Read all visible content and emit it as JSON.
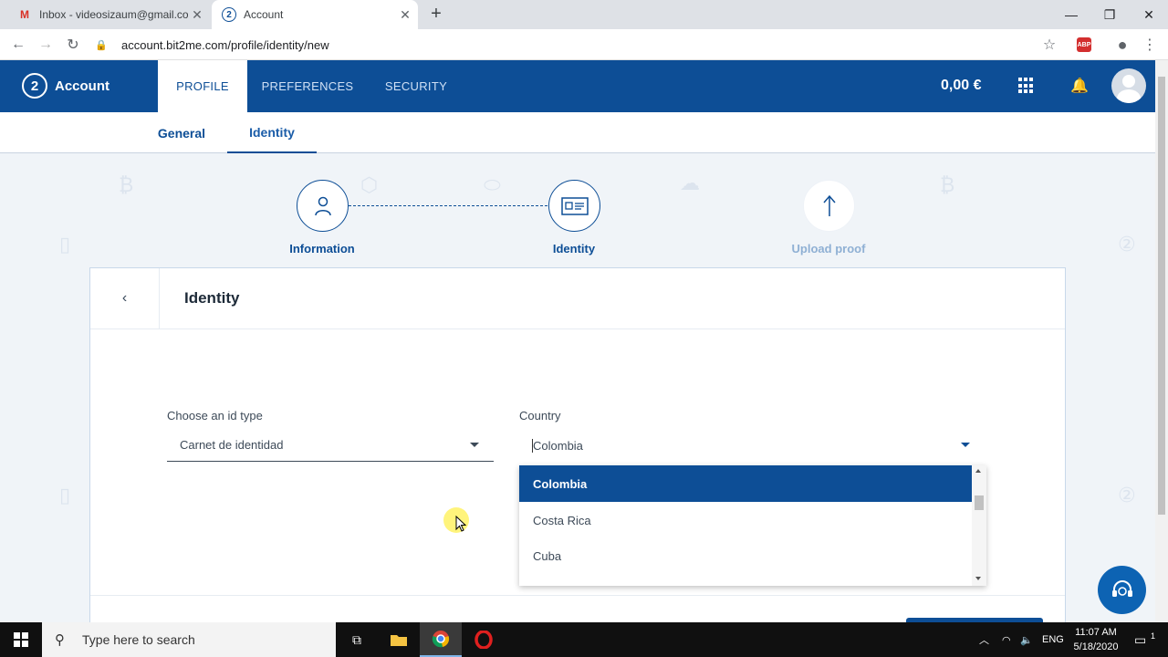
{
  "browser": {
    "tabs": [
      {
        "title": "Inbox - videosizaum@gmail.com",
        "favicon": "gmail-icon",
        "active": false
      },
      {
        "title": "Account",
        "favicon": "bit2me-icon",
        "active": true
      }
    ],
    "new_tab": "+",
    "url": "account.bit2me.com/profile/identity/new",
    "abp": "ABP"
  },
  "header": {
    "logo_number": "2",
    "logo_text": "Account",
    "nav": [
      "PROFILE",
      "PREFERENCES",
      "SECURITY"
    ],
    "balance": "0,00 €"
  },
  "subnav": [
    "General",
    "Identity"
  ],
  "steps": [
    {
      "label": "Information",
      "icon": "person-icon",
      "state": "done"
    },
    {
      "label": "Identity",
      "icon": "id-card-icon",
      "state": "current"
    },
    {
      "label": "Upload proof",
      "icon": "upload-arrow-icon",
      "state": "pending"
    }
  ],
  "card": {
    "back": "‹",
    "title": "Identity",
    "id_type": {
      "label": "Choose an id type",
      "value": "Carnet de identidad"
    },
    "country": {
      "label": "Country",
      "value": "Colombia",
      "options": [
        "Colombia",
        "Costa Rica",
        "Cuba"
      ],
      "selected": "Colombia"
    }
  },
  "taskbar": {
    "search_placeholder": "Type here to search",
    "lang": "ENG",
    "time": "11:07 AM",
    "date": "5/18/2020",
    "notifications": "1"
  },
  "colors": {
    "brand": "#0d4e96",
    "accent": "#0d63b3"
  }
}
